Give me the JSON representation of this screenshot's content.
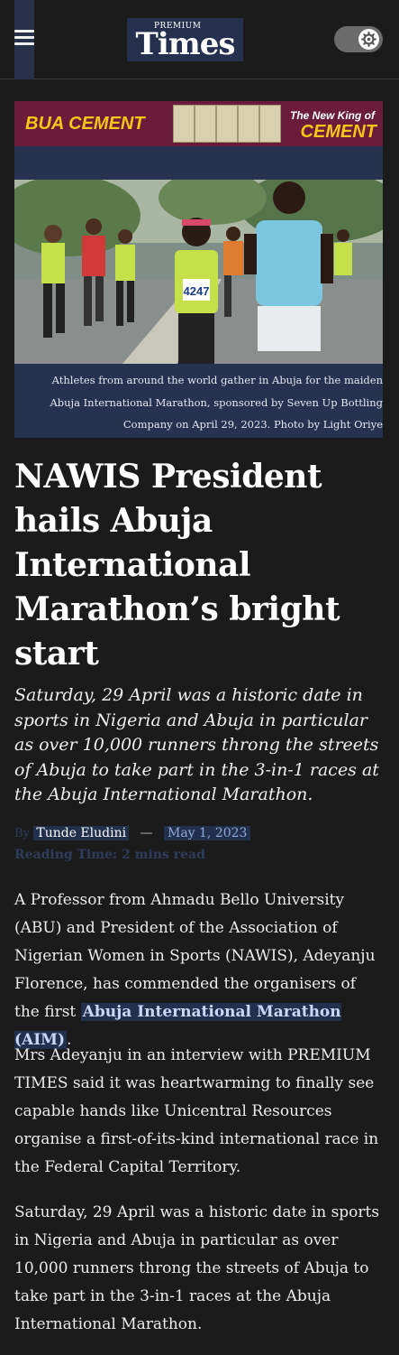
{
  "header": {
    "menu_icon": "hamburger-icon",
    "logo_small": "PREMIUM",
    "logo_big": "Times",
    "theme_toggle_icon": "gear-icon"
  },
  "ad": {
    "brand": "BUA CEMENT",
    "tagline_top": "The New King of",
    "tagline_bottom": "CEMENT"
  },
  "figure": {
    "bib_number": "4247",
    "caption": "Athletes from around the world gather in Abuja for the maiden Abuja International Marathon, sponsored by Seven Up Bottling Company on April 29, 2023. Photo by Light Oriye"
  },
  "article": {
    "headline": "NAWIS President hails Abuja International Marathon’s bright start",
    "dek": "Saturday, 29 April was a historic date in sports in Nigeria and Abuja in particular as over 10,000 runners throng the streets of Abuja to take part in the 3-in-1 races at the Abuja International Marathon.",
    "by_label": "By",
    "author": "Tunde Eludini",
    "separator": "—",
    "date": "May 1, 2023",
    "reading_time": "Reading Time: 2 mins read",
    "p1_before": "A Professor from Ahmadu Bello University (ABU) and President of the Association of Nigerian Women in Sports (NAWIS), Adeyanju Florence, has commended the organisers of the first ",
    "p1_link": "Abuja International Marathon (AIM)",
    "p1_after": ".",
    "p2": "Mrs Adeyanju in an interview with PREMIUM TIMES said it was heartwarming to finally see capable hands like Unicentral Resources organise a first-of-its-kind international race in the Federal Capital Territory.",
    "p3": "Saturday, 29 April was a historic date in sports in Nigeria and Abuja in particular as over 10,000 runners throng the streets of Abuja to take part in the 3-in-1 races at the Abuja International Marathon."
  },
  "colors": {
    "background": "#1b1b1b",
    "accent_navy": "#22304e",
    "ad_background": "#6b1c3a",
    "ad_yellow": "#f5c518"
  }
}
